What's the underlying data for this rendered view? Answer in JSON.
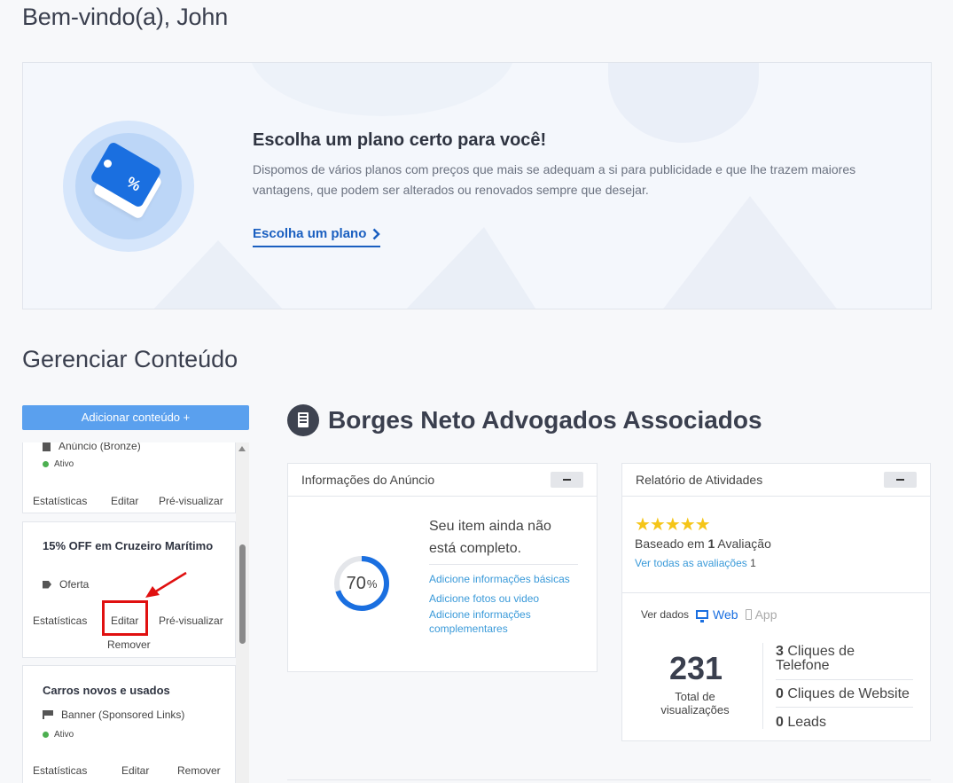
{
  "header": {
    "welcome": "Bem-vindo(a), John"
  },
  "promo": {
    "title": "Escolha um plano certo para você!",
    "text": "Dispomos de vários planos com preços que mais se adequam a si para publicidade e que lhe trazem maiores vantagens, que podem ser alterados ou renovados sempre que desejar.",
    "link_label": "Escolha um plano",
    "icon_text": "%",
    "icon": "price-tag-icon"
  },
  "manage": {
    "title": "Gerenciar Conteúdo",
    "add_button": "Adicionar conteúdo +",
    "items": [
      {
        "type": "Anúncio (Bronze)",
        "status": "Ativo",
        "actions": [
          "Estatísticas",
          "Editar",
          "Pré-visualizar"
        ]
      },
      {
        "title": "15% OFF em Cruzeiro Marítimo",
        "type": "Oferta",
        "actions": [
          "Estatísticas",
          "Editar",
          "Pré-visualizar",
          "Remover"
        ]
      },
      {
        "title": "Carros novos e usados",
        "type": "Banner (Sponsored Links)",
        "status": "Ativo",
        "actions": [
          "Estatísticas",
          "Editar",
          "Remover"
        ]
      }
    ]
  },
  "listing": {
    "name": "Borges Neto Advogados Associados",
    "info_panel": {
      "title": "Informações do Anúncio",
      "progress_value": "70",
      "progress_unit": "%",
      "progress_fraction": 0.7,
      "message": "Seu item ainda não está completo.",
      "tasks": [
        "Adicione informações básicas",
        "Adicione fotos ou video",
        "Adicione informações complementares"
      ]
    },
    "activity_panel": {
      "title": "Relatório de Atividades",
      "stars": "★★★★★",
      "rating_count": "1",
      "based_on_prefix": "Baseado em",
      "based_on_suffix": "Avaliação",
      "see_all": "Ver todas as avaliações",
      "see_all_count": "1",
      "view_data": "Ver dados",
      "web_label": "Web",
      "app_label": "App",
      "views": "231",
      "views_label": "Total de visualizações",
      "stats": [
        {
          "value": "3",
          "label": "Cliques de Telefone"
        },
        {
          "value": "0",
          "label": "Cliques de Website"
        },
        {
          "value": "0",
          "label": "Leads"
        }
      ]
    }
  },
  "colors": {
    "accent": "#1a6fe0",
    "button": "#5aa0ee",
    "link": "#3a9ad9",
    "star": "#f5c518",
    "highlight": "#e01010"
  }
}
